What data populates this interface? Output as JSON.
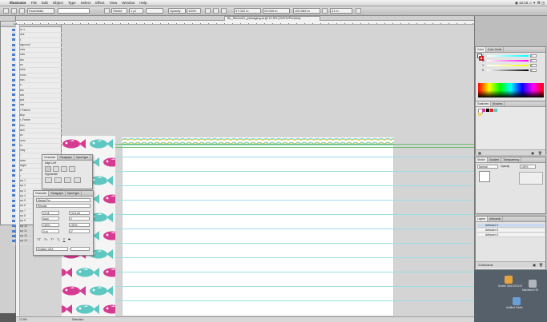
{
  "menubar": {
    "app_name": "Illustrator",
    "items": [
      "File",
      "Edit",
      "Object",
      "Type",
      "Select",
      "Effect",
      "View",
      "Window",
      "Help"
    ],
    "status_right": "◉ 12:16 ♫ ✦ ⌘ ◷"
  },
  "control_bar": {
    "mode_label": "Essentials",
    "stroke_label": "Stroke",
    "stroke_value": "1 pt",
    "opacity_label": "Opacity",
    "opacity_value": "100%",
    "x_value": "37.022 in",
    "y_value": "20.000 in",
    "w_value": "100.083 in",
    "h_value": "21 in"
  },
  "document": {
    "tab_title": "BL_Stereo01_packaging.ai @ 12.5% (CMYK/Preview)",
    "zoom": "12.5%",
    "status": "Selection"
  },
  "layers": {
    "header": "LAYERS",
    "items": [
      "Layer 1",
      "Guides",
      "Text",
      "Background",
      "Frames",
      "Artwork",
      "Labels",
      "Notes",
      "Borders",
      "Chevron",
      "Ribbon",
      "Dots",
      "Hearts",
      "Waves",
      "Stripes",
      "Circles",
      "Fish Pattern",
      "Scallop",
      "Fish_Frame",
      "Pattern",
      "Swatch",
      "Holes",
      "Corners",
      "Lines",
      "Overlay",
      "Tint",
      "Shadow",
      "Highlight",
      "Mask",
      "Clip",
      "Group 1",
      "Group 2",
      "Group 3",
      "Group 4",
      "Group 5",
      "Group 6",
      "Group 7",
      "Group 8",
      "Group 9",
      "Group 10",
      "Group 11",
      "Group 12",
      "Group 13"
    ]
  },
  "paragraph_panel": {
    "tabs": [
      "Character",
      "Paragraph",
      "OpenType"
    ],
    "label_1": "Align Left",
    "label_2": "Hyphenate"
  },
  "character_panel": {
    "tabs": [
      "Character",
      "Paragraph",
      "OpenType"
    ],
    "font_family": "Myriad Pro",
    "font_style": "Regular",
    "size": "12 pt",
    "leading": "(14.4 pt)",
    "kerning": "Auto",
    "tracking": "0",
    "v_scale": "100%",
    "h_scale": "100%",
    "baseline": "0 pt",
    "rotation": "0°",
    "language": "English: USA"
  },
  "color_panel": {
    "tabs": [
      "Color",
      "Color Guide"
    ],
    "channels": [
      {
        "label": "C",
        "value": "0"
      },
      {
        "label": "M",
        "value": "0"
      },
      {
        "label": "Y",
        "value": "0"
      },
      {
        "label": "K",
        "value": "0"
      }
    ]
  },
  "swatches_panel": {
    "tabs": [
      "Swatches",
      "Brushes"
    ]
  },
  "transform_panel": {
    "tabs": [
      "Stroke",
      "Gradient",
      "Transparency"
    ],
    "blend_mode": "Normal",
    "opacity_label": "Opacity",
    "opacity_value": "100%"
  },
  "artboards_panel": {
    "tabs": [
      "Layers",
      "Artboards"
    ],
    "items": [
      "Artboard 1",
      "Artboard 2",
      "Artboard 3"
    ],
    "footer": "3 Artboards"
  },
  "desktop": {
    "icons": [
      {
        "label": "Screen Shot 2013-01",
        "color": "#e8a43c"
      },
      {
        "label": "Macintosh HD",
        "color": "#b0b6bc"
      },
      {
        "label": "Untitled Folder",
        "color": "#6aa0d8"
      }
    ]
  },
  "colors": {
    "fish_pink": "#d63b92",
    "fish_teal": "#5fc7c1",
    "guide_green": "#67c16a",
    "line_blue": "#9cdde6"
  }
}
